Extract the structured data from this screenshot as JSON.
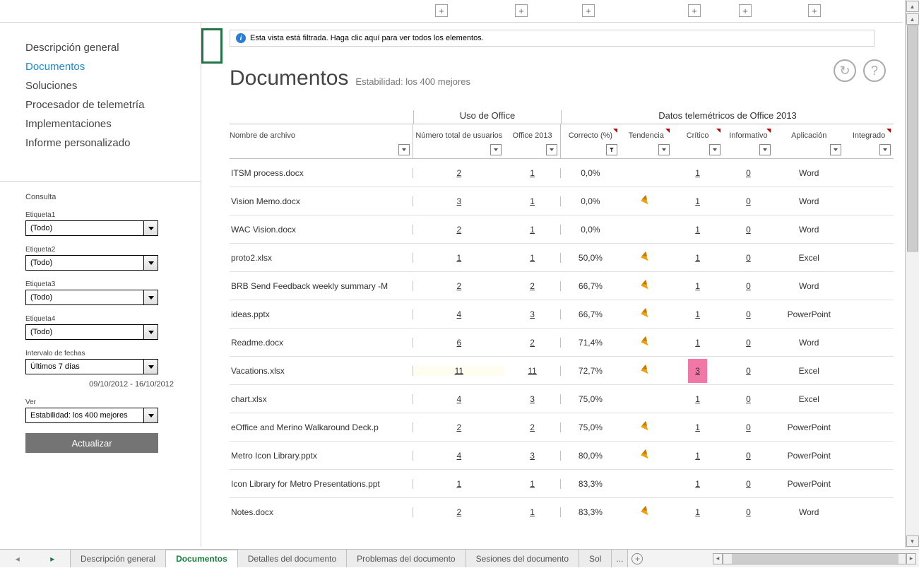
{
  "plus_positions": [
    616,
    729,
    824,
    974,
    1046,
    1144
  ],
  "nav": {
    "items": [
      "Descripción general",
      "Documentos",
      "Soluciones",
      "Procesador de telemetría",
      "Implementaciones",
      "Informe personalizado"
    ],
    "active": 1
  },
  "query": {
    "title": "Consulta",
    "labels": [
      "Etiqueta1",
      "Etiqueta2",
      "Etiqueta3",
      "Etiqueta4"
    ],
    "option_all": "(Todo)",
    "date_label": "Intervalo de fechas",
    "date_option": "Últimos 7 días",
    "date_range": "09/10/2012 - 16/10/2012",
    "view_label": "Ver",
    "view_option": "Estabilidad: los 400 mejores",
    "update_btn": "Actualizar"
  },
  "banner": "Esta vista está filtrada. Haga clic aquí para ver todos los elementos.",
  "page": {
    "title": "Documentos",
    "subtitle": "Estabilidad: los 400 mejores"
  },
  "groups": {
    "office_usage": "Uso de Office",
    "telemetry": "Datos telemétricos de Office 2013"
  },
  "columns": {
    "name": "Nombre de archivo",
    "users": "Número total de usuarios",
    "office": "Office 2013",
    "correct": "Correcto (%)",
    "trend": "Tendencia",
    "crit": "Crítico",
    "info": "Informativo",
    "app": "Aplicación",
    "int": "Integrado"
  },
  "rows": [
    {
      "name": "ITSM process.docx",
      "users": "2",
      "office": "1",
      "correct": "0,0%",
      "trend": false,
      "crit": "1",
      "info": "0",
      "app": "Word"
    },
    {
      "name": "Vision Memo.docx",
      "users": "3",
      "office": "1",
      "correct": "0,0%",
      "trend": true,
      "crit": "1",
      "info": "0",
      "app": "Word"
    },
    {
      "name": "WAC Vision.docx",
      "users": "2",
      "office": "1",
      "correct": "0,0%",
      "trend": false,
      "crit": "1",
      "info": "0",
      "app": "Word"
    },
    {
      "name": "proto2.xlsx",
      "users": "1",
      "office": "1",
      "correct": "50,0%",
      "trend": true,
      "crit": "1",
      "info": "0",
      "app": "Excel"
    },
    {
      "name": "BRB Send Feedback weekly summary -M",
      "users": "2",
      "office": "2",
      "correct": "66,7%",
      "trend": true,
      "crit": "1",
      "info": "0",
      "app": "Word"
    },
    {
      "name": "ideas.pptx",
      "users": "4",
      "office": "3",
      "correct": "66,7%",
      "trend": true,
      "crit": "1",
      "info": "0",
      "app": "PowerPoint"
    },
    {
      "name": "Readme.docx",
      "users": "6",
      "office": "2",
      "correct": "71,4%",
      "trend": true,
      "crit": "1",
      "info": "0",
      "app": "Word"
    },
    {
      "name": "Vacations.xlsx",
      "users": "11",
      "office": "11",
      "correct": "72,7%",
      "trend": true,
      "crit": "3",
      "crit_hot": true,
      "users_warm": true,
      "info": "0",
      "app": "Excel"
    },
    {
      "name": "chart.xlsx",
      "users": "4",
      "office": "3",
      "correct": "75,0%",
      "trend": false,
      "crit": "1",
      "info": "0",
      "app": "Excel"
    },
    {
      "name": "eOffice and Merino Walkaround Deck.p",
      "users": "2",
      "office": "2",
      "correct": "75,0%",
      "trend": true,
      "crit": "1",
      "info": "0",
      "app": "PowerPoint"
    },
    {
      "name": "Metro Icon Library.pptx",
      "users": "4",
      "office": "3",
      "correct": "80,0%",
      "trend": true,
      "crit": "1",
      "info": "0",
      "app": "PowerPoint"
    },
    {
      "name": "Icon Library for Metro Presentations.ppt",
      "users": "1",
      "office": "1",
      "correct": "83,3%",
      "trend": false,
      "crit": "1",
      "info": "0",
      "app": "PowerPoint"
    },
    {
      "name": "Notes.docx",
      "users": "2",
      "office": "1",
      "correct": "83,3%",
      "trend": true,
      "crit": "1",
      "info": "0",
      "app": "Word"
    }
  ],
  "tabs": {
    "items": [
      "Descripción general",
      "Documentos",
      "Detalles del documento",
      "Problemas del documento",
      "Sesiones del documento",
      "Sol"
    ],
    "more": "...",
    "active": 1
  }
}
